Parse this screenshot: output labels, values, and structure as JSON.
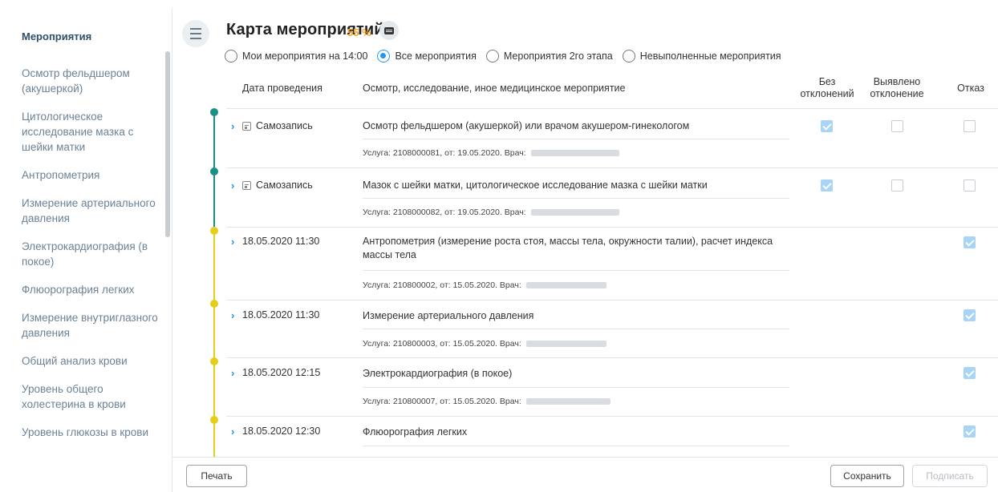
{
  "sidebar": {
    "title": "Мероприятия",
    "items": [
      "Осмотр фельдшером (акушеркой)",
      "Цитологическое исследование мазка с шейки матки",
      "Антропометрия",
      "Измерение артериального давления",
      "Электрокардиография (в покое)",
      "Флюорография легких",
      "Измерение внутриглазного давления",
      "Общий анализ крови",
      "Уровень общего холестерина в крови",
      "Уровень глюкозы в крови"
    ]
  },
  "header": {
    "title": "Карта мероприятий",
    "percent": "55 %",
    "icon": "card-icon"
  },
  "filters": [
    {
      "label": "Мои мероприятия на 14:00",
      "checked": false
    },
    {
      "label": "Все мероприятия",
      "checked": true
    },
    {
      "label": "Мероприятия 2го этапа",
      "checked": false
    },
    {
      "label": "Невыполненные мероприятия",
      "checked": false
    }
  ],
  "table": {
    "columns": {
      "date": "Дата проведения",
      "name": "Осмотр, исследование, иное медицинское мероприятие",
      "no_dev_1": "Без",
      "no_dev_2": "отклонений",
      "dev_1": "Выявлено",
      "dev_2": "отклонение",
      "refusal": "Отказ"
    },
    "rows": [
      {
        "date": "Самозапись",
        "self": true,
        "name": "Осмотр фельдшером (акушеркой) или врачом акушером-гинекологом",
        "service": "Услуга: 2108000081, от: 19.05.2020. Врач:",
        "no_dev": true,
        "dev": false,
        "refusal": false
      },
      {
        "date": "Самозапись",
        "self": true,
        "name": "Мазок с шейки матки, цитологическое исследование мазка с шейки матки",
        "service": "Услуга: 2108000082, от: 19.05.2020. Врач:",
        "no_dev": true,
        "dev": false,
        "refusal": false
      },
      {
        "date": "18.05.2020 11:30",
        "self": false,
        "name": "Антропометрия (измерение роста стоя, массы тела, окружности талии), расчет индекса массы тела",
        "service": "Услуга: 210800002, от: 15.05.2020. Врач:",
        "refusal": true
      },
      {
        "date": "18.05.2020 11:30",
        "self": false,
        "name": "Измерение артериального давления",
        "service": "Услуга: 210800003, от: 15.05.2020. Врач:",
        "refusal": true
      },
      {
        "date": "18.05.2020 12:15",
        "self": false,
        "name": "Электрокардиография (в покое)",
        "service": "Услуга: 210800007, от: 15.05.2020. Врач:",
        "refusal": true
      },
      {
        "date": "18.05.2020 12:30",
        "self": false,
        "name": "Флюорография легких",
        "refusal": true
      }
    ]
  },
  "buttons": {
    "print": "Печать",
    "save": "Сохранить",
    "sign": "Подписать"
  },
  "colors": {
    "timeline_teal": "#1b8f86",
    "timeline_yellow": "#e3cf1a",
    "accent": "#2196f3",
    "percent": "#f5a623"
  }
}
